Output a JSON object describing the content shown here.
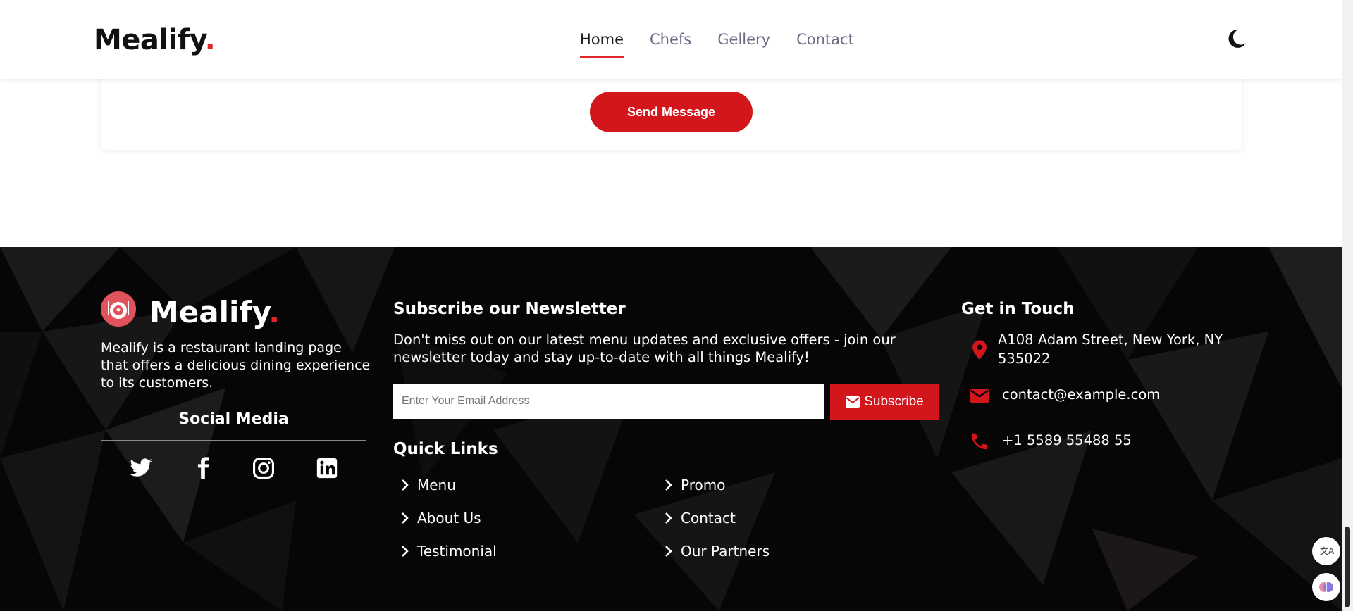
{
  "header": {
    "brand": "Mealify",
    "brand_dot": ".",
    "nav": [
      "Home",
      "Chefs",
      "Gellery",
      "Contact"
    ],
    "active_nav": "Home",
    "theme_icon": "moon-icon"
  },
  "form": {
    "send_label": "Send Message"
  },
  "footer": {
    "brand": "Mealify",
    "brand_dot": ".",
    "description": "Mealify is a restaurant landing page that offers a delicious dining experience to its customers.",
    "social_title": "Social Media",
    "social_icons": [
      "twitter-icon",
      "facebook-icon",
      "instagram-icon",
      "linkedin-icon"
    ],
    "newsletter": {
      "title": "Subscribe our Newsletter",
      "text": "Don't miss out on our latest menu updates and exclusive offers - join our newsletter today and stay up-to-date with all things Mealify!",
      "placeholder": "Enter Your Email Address",
      "button": "Subscribe"
    },
    "quick_links": {
      "title": "Quick Links",
      "items": [
        "Menu",
        "Promo",
        "About Us",
        "Contact",
        "Testimonial",
        "Our Partners"
      ]
    },
    "contact": {
      "title": "Get in Touch",
      "address": "A108 Adam Street, New York, NY 535022",
      "email": "contact@example.com",
      "phone": "+1 5589 55488 55"
    }
  },
  "colors": {
    "accent": "#d3151c",
    "footer_bg": "#060606",
    "nav_inactive": "#6b6b86"
  }
}
